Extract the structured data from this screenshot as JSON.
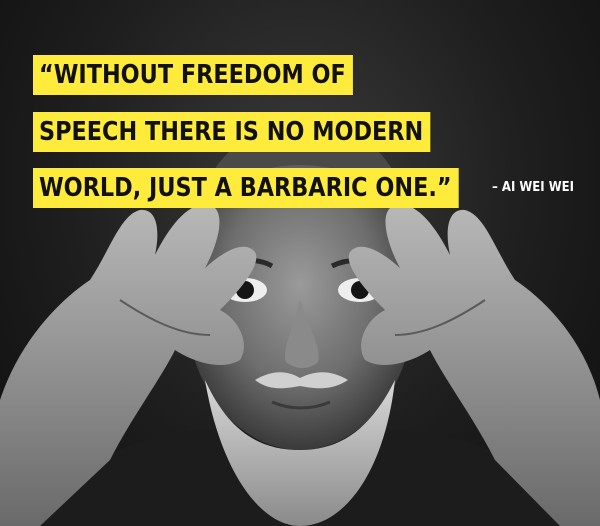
{
  "quote": {
    "line1": "“WITHOUT FREEDOM OF",
    "line2": "SPEECH THERE IS NO MODERN",
    "line3": "WORLD, JUST A BARBARIC ONE.”",
    "attribution": "– AI WEI WEI"
  },
  "colors": {
    "highlight": "#ffeb3b",
    "text": "#111111",
    "attribution": "#ffffff",
    "background": "#1a1a1a"
  }
}
